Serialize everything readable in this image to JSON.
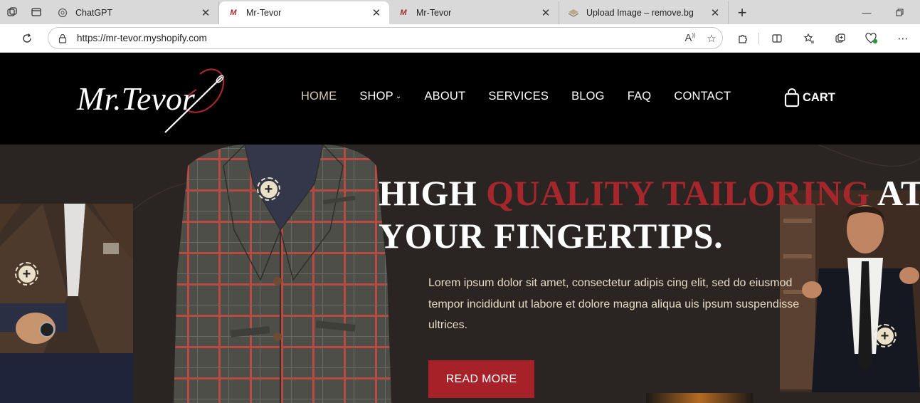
{
  "browser": {
    "tabs": [
      {
        "title": "ChatGPT",
        "favicon": "chatgpt-icon",
        "active": false
      },
      {
        "title": "Mr-Tevor",
        "favicon": "mr-tevor-icon",
        "active": true
      },
      {
        "title": "Mr-Tevor",
        "favicon": "mr-tevor-icon",
        "active": false
      },
      {
        "title": "Upload Image – remove.bg",
        "favicon": "removebg-icon",
        "active": false
      }
    ],
    "url": "https://mr-tevor.myshopify.com"
  },
  "site": {
    "logo_text": "Mr.Tevor",
    "nav": [
      {
        "label": "HOME",
        "active": true
      },
      {
        "label": "SHOP",
        "has_dropdown": true
      },
      {
        "label": "ABOUT"
      },
      {
        "label": "SERVICES"
      },
      {
        "label": "BLOG"
      },
      {
        "label": "FAQ"
      },
      {
        "label": "CONTACT"
      }
    ],
    "cart_label": "CART"
  },
  "hero": {
    "headline_part1": "HIGH ",
    "headline_accent": "QUALITY TAILORING",
    "headline_part2": " AT",
    "headline_line2": "YOUR FINGERTIPS.",
    "body": "Lorem ipsum dolor sit amet, consectetur adipis cing elit, sed do eiusmod tempor incididunt ut labore et dolore magna aliqua uis ipsum suspendisse ultrices.",
    "cta_label": "READ MORE"
  },
  "colors": {
    "header_bg": "#000000",
    "hero_bg": "#2a2523",
    "accent_red": "#a5272c",
    "nav_active": "#d9c9b3",
    "body_text": "#e6dcc3"
  }
}
